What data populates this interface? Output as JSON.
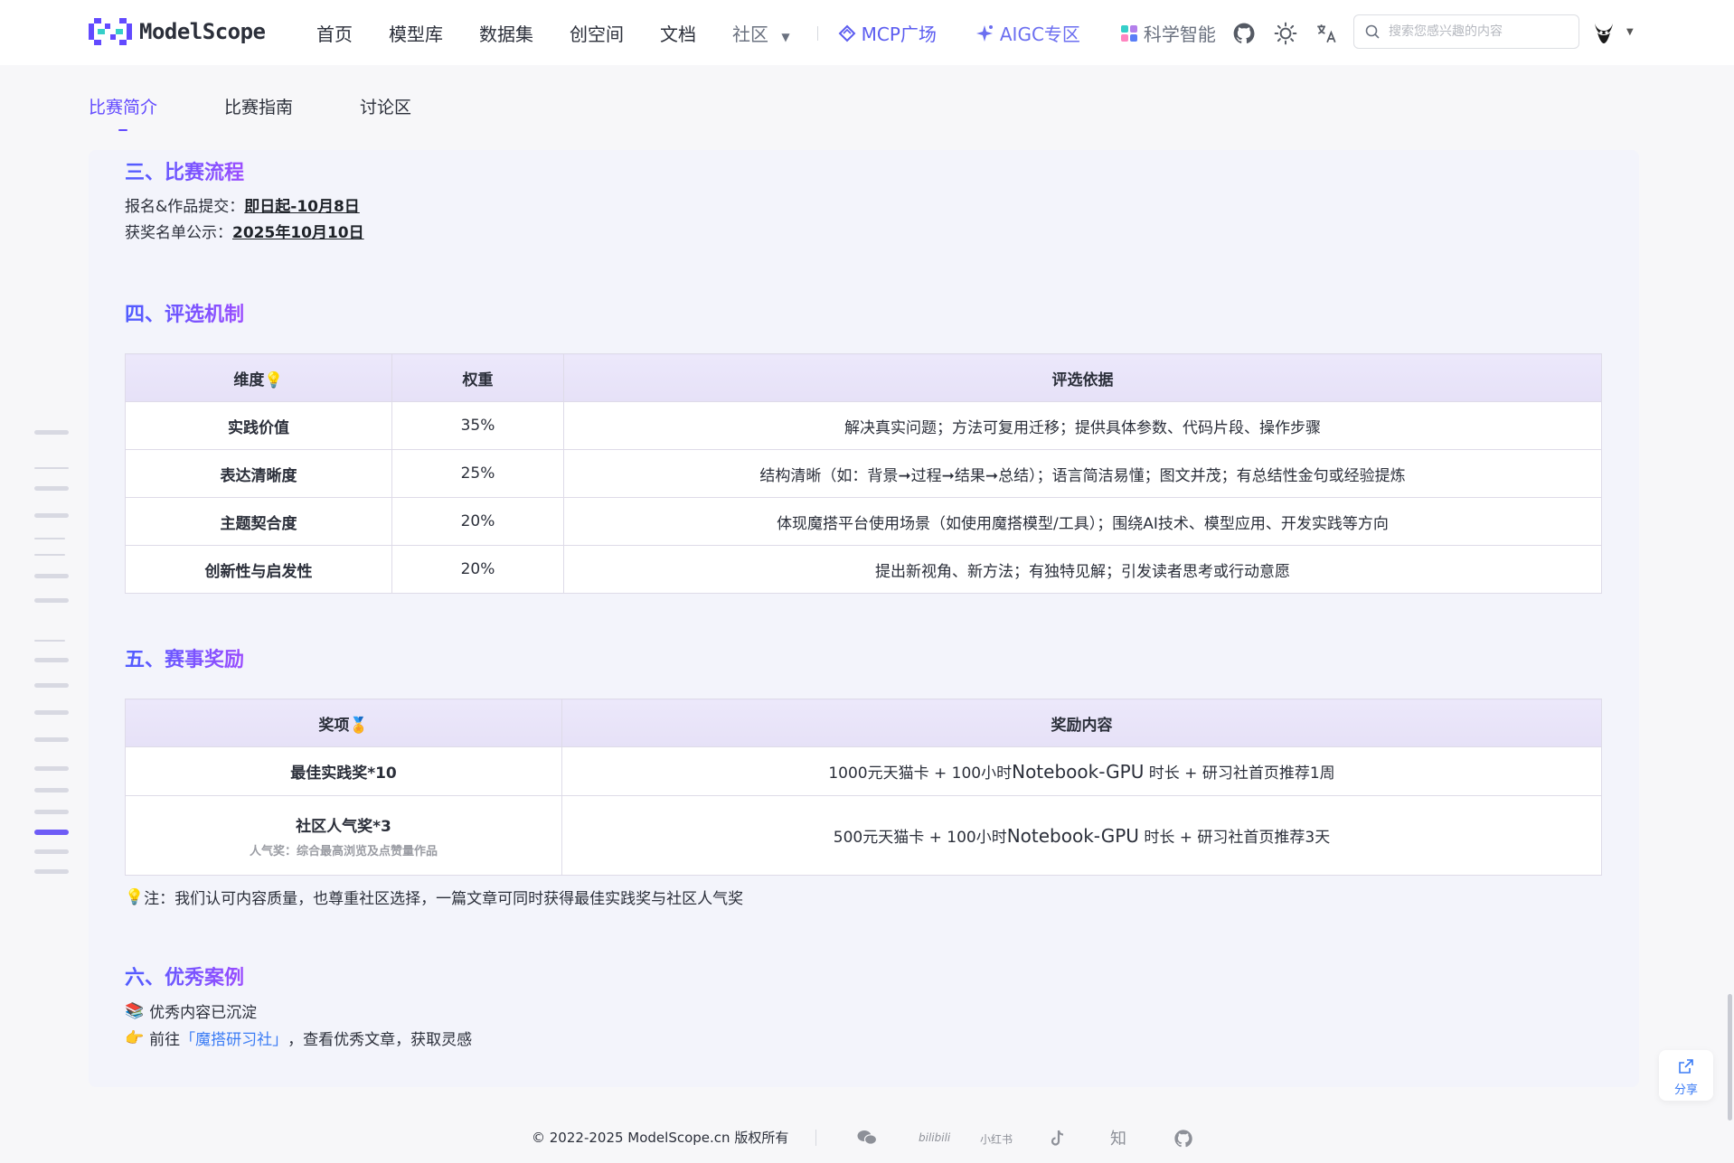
{
  "nav": {
    "logo_text": "ModelScope",
    "items": [
      "首页",
      "模型库",
      "数据集",
      "创空间",
      "文档"
    ],
    "community": "社区",
    "mcp": "MCP广场",
    "aigc": "AIGC专区",
    "science": "科学智能",
    "search_placeholder": "搜索您感兴趣的内容"
  },
  "subtabs": [
    "比赛简介",
    "比赛指南",
    "讨论区"
  ],
  "section3": {
    "title": "三、比赛流程",
    "row1_label": "报名&作品提交：",
    "row1_value": "即日起-10月8日",
    "row2_label": "获奖名单公示：",
    "row2_value": "2025年10月10日"
  },
  "section4": {
    "title": "四、评选机制",
    "headers": [
      "维度💡",
      "权重",
      "评选依据"
    ],
    "rows": [
      [
        "实践价值",
        "35%",
        "解决真实问题；方法可复用迁移；提供具体参数、代码片段、操作步骤"
      ],
      [
        "表达清晰度",
        "25%",
        "结构清晰（如：背景➞过程➞结果➞总结）；语言简洁易懂；图文并茂；有总结性金句或经验提炼"
      ],
      [
        "主题契合度",
        "20%",
        "体现魔搭平台使用场景（如使用魔搭模型/工具）；围绕AI技术、模型应用、开发实践等方向"
      ],
      [
        "创新性与启发性",
        "20%",
        "提出新视角、新方法；有独特见解；引发读者思考或行动意愿"
      ]
    ]
  },
  "section5": {
    "title": "五、赛事奖励",
    "headers": [
      "奖项🏅",
      "奖励内容"
    ],
    "award1_name": "最佳实践奖*10",
    "award1_prefix": "1000元天猫卡 + 100小时",
    "award1_big": "Notebook-GPU",
    "award1_suffix": " 时长 +  研习社首页推荐1周",
    "award2_name": "社区人气奖*3",
    "award2_note": "人气奖：综合最高浏览及点赞量作品",
    "award2_prefix": "500元天猫卡 + 100小时",
    "award2_big": "Notebook-GPU",
    "award2_suffix": " 时长 + 研习社首页推荐3天",
    "note": "注：我们认可内容质量，也尊重社区选择，一篇文章可同时获得最佳实践奖与社区人气奖"
  },
  "section6": {
    "title": "六、优秀案例",
    "line1": "优秀内容已沉淀",
    "line2_prefix": "前往",
    "line2_link": "「魔搭研习社」",
    "line2_suffix": "，查看优秀文章，获取灵感"
  },
  "share_label": "分享",
  "footer": {
    "copyright": "© 2022-2025 ModelScope.cn 版权所有",
    "bilibili": "bilibili",
    "xiaohongshu": "小红书",
    "zhihu": "知"
  },
  "colors": {
    "accent": "#624aff",
    "link": "#3b7cf5"
  }
}
